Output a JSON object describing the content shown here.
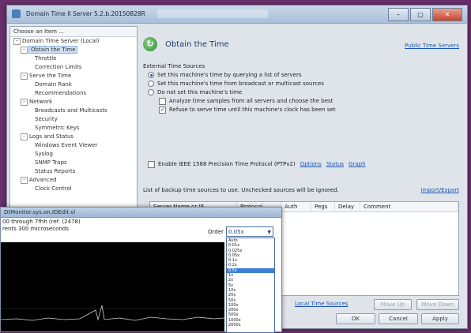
{
  "window": {
    "title": "Domain Time II Server 5.2.b.20150828R",
    "min_glyph": "–",
    "max_glyph": "▢",
    "close_glyph": "✕"
  },
  "sidebar": {
    "header": "Choose an Item ...",
    "items": [
      {
        "label": "Domain Time Server (Local)",
        "depth": 0,
        "expander": "–"
      },
      {
        "label": "Obtain the Time",
        "depth": 1,
        "expander": "–",
        "selected": true
      },
      {
        "label": "Throttle",
        "depth": 2
      },
      {
        "label": "Correction Limits",
        "depth": 2
      },
      {
        "label": "Serve the Time",
        "depth": 1,
        "expander": "–"
      },
      {
        "label": "Domain Rank",
        "depth": 2
      },
      {
        "label": "Recommendations",
        "depth": 2
      },
      {
        "label": "Network",
        "depth": 1,
        "expander": "–"
      },
      {
        "label": "Broadcasts and Multicasts",
        "depth": 2
      },
      {
        "label": "Security",
        "depth": 2
      },
      {
        "label": "Symmetric Keys",
        "depth": 2
      },
      {
        "label": "Logs and Status",
        "depth": 1,
        "expander": "–"
      },
      {
        "label": "Windows Event Viewer",
        "depth": 2
      },
      {
        "label": "Syslog",
        "depth": 2
      },
      {
        "label": "SNMP Traps",
        "depth": 2
      },
      {
        "label": "Status Reports",
        "depth": 2
      },
      {
        "label": "Advanced",
        "depth": 1,
        "expander": "–"
      },
      {
        "label": "Clock Control",
        "depth": 2
      }
    ]
  },
  "main": {
    "title": "Obtain the Time",
    "icon_glyph": "↻",
    "public_link": "Public Time Servers",
    "external_label": "External Time Sources",
    "options": [
      {
        "label": "Set this machine's time by querying a list of servers",
        "kind": "radio",
        "on": true
      },
      {
        "label": "Set this machine's time from broadcast or multicast sources",
        "kind": "radio",
        "on": false
      },
      {
        "label": "Do not set this machine's time",
        "kind": "radio",
        "on": false
      },
      {
        "label": "Analyze time samples from all servers and choose the best",
        "kind": "check",
        "on": false
      },
      {
        "label": "Refuse to serve time until this machine's clock has been set",
        "kind": "check",
        "on": true
      }
    ],
    "ptp": {
      "label": "Enable IEEE 1588 Precision Time Protocol (PTPv2)",
      "links": [
        "Options",
        "Status",
        "Graph"
      ]
    },
    "backup_label": "List of backup time sources to use. Unchecked sources will be ignored.",
    "import_link": "Import/Export",
    "columns": [
      "Server Name or IP",
      "Protocol",
      "Auth",
      "Pegs",
      "Delay",
      "Comment"
    ],
    "local_link": "Local Time Sources",
    "move_up": "Move Up",
    "move_down": "Move Down",
    "ok": "OK",
    "cancel": "Cancel",
    "apply": "Apply"
  },
  "subwindow": {
    "title": "DtMonitor.sys.on.IDEdit.vi",
    "info_line1": "00 through 7fhh (ref: (2478)",
    "info_line2": "rents 300 microseconds",
    "order_label": "Order",
    "order_value": "0.05x",
    "dropdown_options": [
      "Auto",
      "0.01x",
      "0.025x",
      "0.05x",
      "0.1x",
      "0.2x",
      "0.5x",
      "1x",
      "2x",
      "5x",
      "10x",
      "20x",
      "50x",
      "100x",
      "200x",
      "500x",
      "1000x",
      "2000x"
    ],
    "dropdown_selected": 6
  }
}
